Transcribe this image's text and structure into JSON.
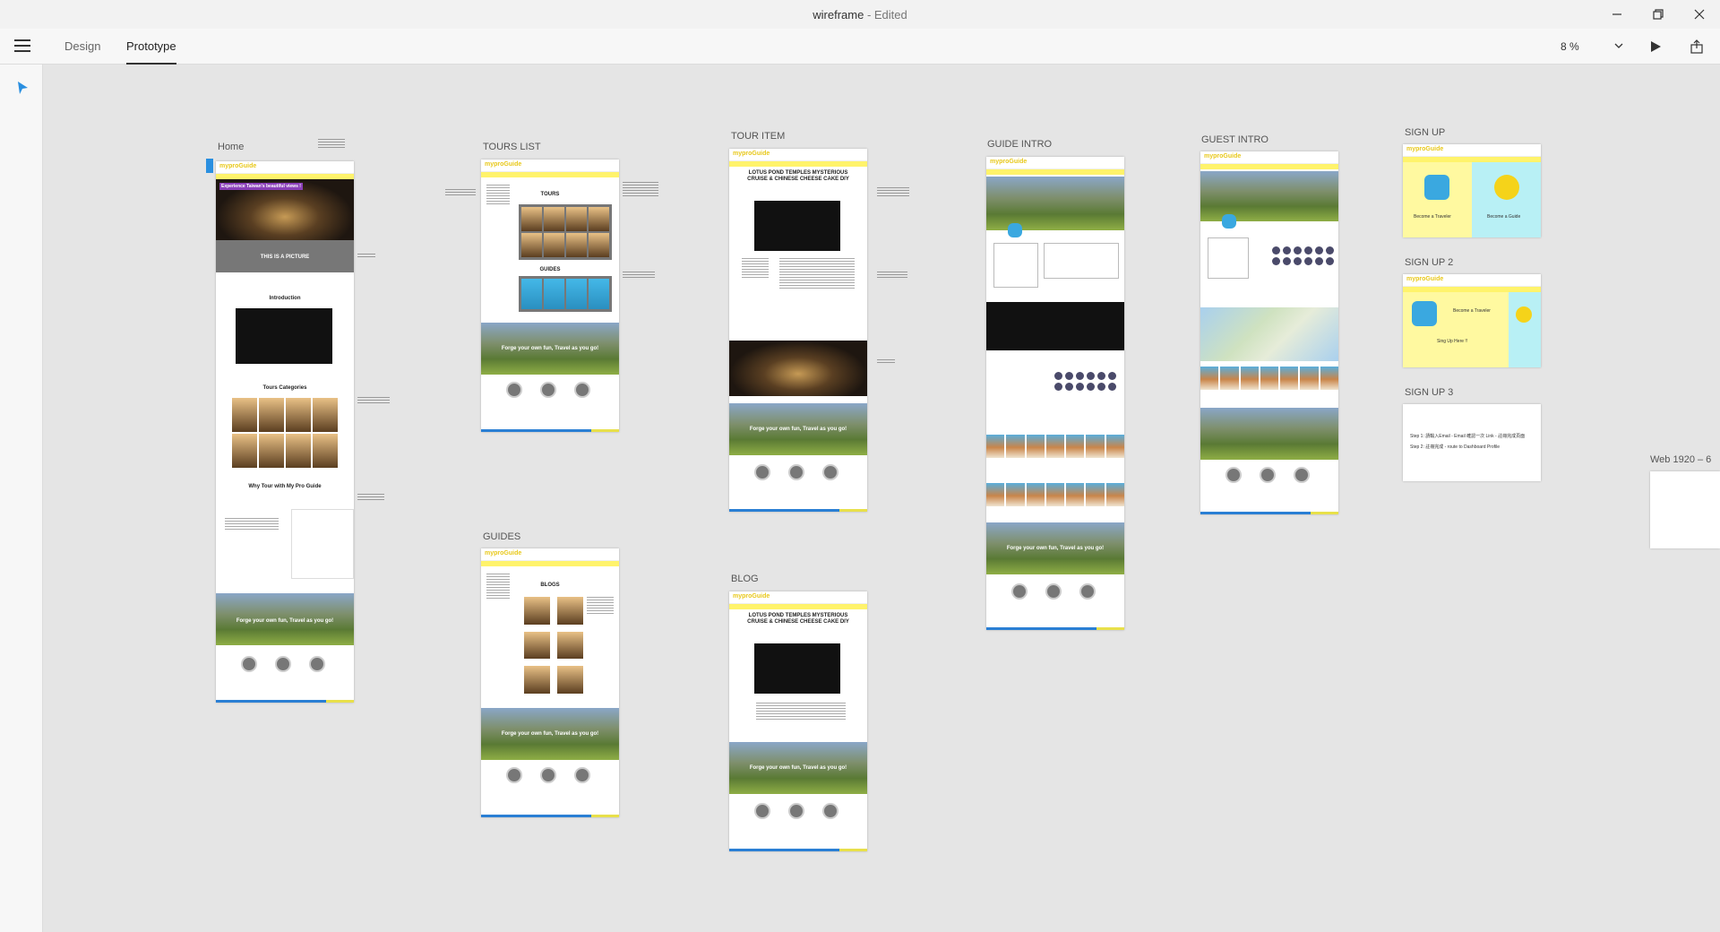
{
  "window": {
    "doc_name": "wireframe",
    "status": " - Edited"
  },
  "toolbar": {
    "tabs": [
      {
        "label": "Design"
      },
      {
        "label": "Prototype"
      }
    ],
    "zoom": "8 %"
  },
  "artboards": {
    "home": "Home",
    "tours_list": "TOURS LIST",
    "tour_item": "TOUR ITEM",
    "guide_intro": "GUIDE INTRO",
    "guest_intro": "GUEST INTRO",
    "sign_up": "SIGN UP",
    "sign_up_2": "SIGN UP 2",
    "sign_up_3": "SIGN UP 3",
    "guides": "GUIDES",
    "blog": "BLOG",
    "web": "Web 1920 – 6"
  },
  "content": {
    "logo_a": "mypro",
    "logo_b": "Guide",
    "home_hero": "Experience Taiwan's beautiful views !",
    "home_picture": "THIS IS A PICTURE",
    "home_intro": "Introduction",
    "home_categories": "Tours Categories",
    "home_why": "Why Tour with My Pro Guide",
    "slogan": "Forge your own fun, Travel as you go!",
    "tours_heading": "TOURS",
    "guides_heading": "GUIDES",
    "blog_heading": "BLOGS",
    "tour_item_title": "LOTUS POND TEMPLES MYSTERIOUS CRUISE & CHINESE CHEESE CAKE DIY",
    "signup_traveler": "Become a Traveler",
    "signup_guide": "Become a Guide",
    "signup2_prompt": "Sing Up Here !!",
    "signup3_line1": "Step 1: 請輸入Email - Email 確認一次 Link - 註冊完成頁面",
    "signup3_line2": "Step 2: 註冊完成 - route to Dashboard Profile"
  }
}
